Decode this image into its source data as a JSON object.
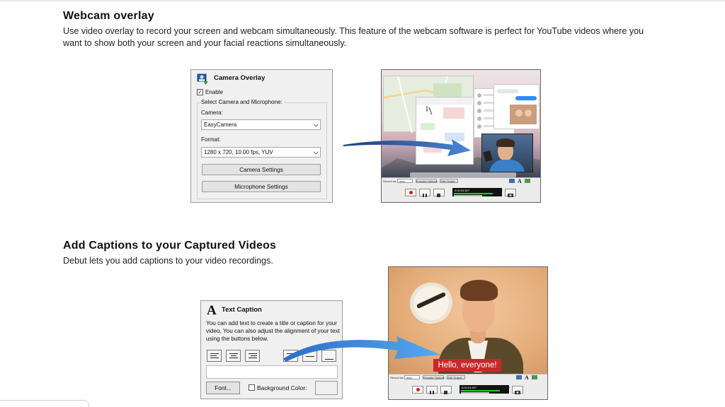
{
  "section1": {
    "heading": "Webcam overlay",
    "paragraph": "Use video overlay to record your screen and webcam simultaneously. This feature of the webcam software is perfect for YouTube videos where you want to show both your screen and your facial reactions simultaneously."
  },
  "camera_dialog": {
    "title": "Camera Overlay",
    "enable_label": "Enable",
    "enable_checked": true,
    "group_label": "Select Camera and Microphone:",
    "camera_label": "Camera:",
    "camera_value": "EasyCamera",
    "format_label": "Format:",
    "format_value": "1280 x 720, 10.00 fps, YUV",
    "camera_settings_button": "Camera Settings",
    "microphone_settings_button": "Microphone Settings"
  },
  "recorder_toolbar": {
    "record_as_label": "Record as:",
    "format_select": ".wmv",
    "encoder_options": "Encoder Options...",
    "edit_output": "Edit Output...",
    "time_display": "0:00:03.527",
    "fps_display": "10 fps"
  },
  "section2": {
    "heading": "Add Captions to your Captured Videos",
    "paragraph": "Debut lets you add captions to your video recordings."
  },
  "caption_dialog": {
    "title": "Text Caption",
    "description": "You can add text to create a title or caption for your video. You can also adjust the alignment of your text using the buttons below.",
    "font_button": "Font...",
    "background_color_label": "Background Color:",
    "background_color_checked": false
  },
  "caption_preview": {
    "caption_text": "Hello, everyone!"
  },
  "colors": {
    "caption_red": "#c8282a",
    "arrow_blue": "#2a6fc7",
    "record_red": "#d21f1f",
    "level_green": "#1fcc2a"
  }
}
